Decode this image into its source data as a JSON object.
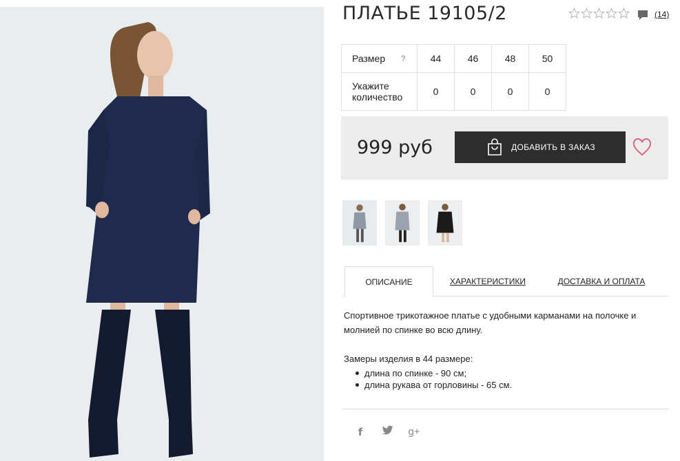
{
  "product": {
    "title": "ПЛАТЬЕ 19105/2",
    "rating_stars": 0,
    "rating_max": 5,
    "reviews_count": "(14)"
  },
  "size_table": {
    "size_label": "Размер",
    "help": "?",
    "qty_label": "Укажите количество",
    "sizes": [
      "44",
      "46",
      "48",
      "50"
    ],
    "quantities": [
      "0",
      "0",
      "0",
      "0"
    ]
  },
  "price": {
    "value": "999 руб",
    "order_button": "ДОБАВИТЬ В ЗАКАЗ"
  },
  "tabs": [
    "ОПИСАНИЕ",
    "ХАРАКТЕРИСТИКИ",
    "ДОСТАВКА И ОПЛАТА"
  ],
  "description": {
    "text": "Спортивное трикотажное платье с удобными карманами на полочке и молнией по спинке во всю длину.",
    "measures_title": "Замеры изделия в 44 размере:",
    "measures": [
      "длина по спинке - 90 см;",
      "длина рукава от горловины - 65 см."
    ]
  },
  "social": {
    "facebook": "f",
    "googleplus": "g+"
  },
  "colors": {
    "dress": "#1f2a4d",
    "button_bg": "#2d2d2d",
    "price_bg": "#ececec",
    "heart": "#d9687e"
  },
  "icons": {
    "rating": "star-outline-icon",
    "comment": "comment-bubble-icon",
    "order": "shopping-bag-icon",
    "wishlist": "heart-outline-icon",
    "facebook": "facebook-icon",
    "twitter": "twitter-icon",
    "googleplus": "google-plus-icon"
  }
}
